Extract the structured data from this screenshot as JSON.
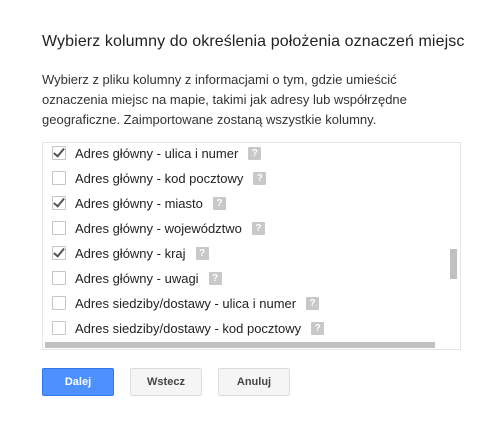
{
  "dialog": {
    "title": "Wybierz kolumny do określenia położenia oznaczeń miejsc",
    "description": "Wybierz z pliku kolumny z informacjami o tym, gdzie umieścić oznaczenia miejsc na mapie, takimi jak adresy lub współrzędne geograficzne. Zaimportowane zostaną wszystkie kolumny."
  },
  "columns": [
    {
      "label": "Adres główny - ulica i numer",
      "checked": true
    },
    {
      "label": "Adres główny - kod pocztowy",
      "checked": false
    },
    {
      "label": "Adres główny - miasto",
      "checked": true
    },
    {
      "label": "Adres główny - województwo",
      "checked": false
    },
    {
      "label": "Adres główny - kraj",
      "checked": true
    },
    {
      "label": "Adres główny - uwagi",
      "checked": false
    },
    {
      "label": "Adres siedziby/dostawy - ulica i numer",
      "checked": false
    },
    {
      "label": "Adres siedziby/dostawy - kod pocztowy",
      "checked": false
    }
  ],
  "help_glyph": "?",
  "buttons": {
    "next": "Dalej",
    "back": "Wstecz",
    "cancel": "Anuluj"
  },
  "colors": {
    "primary": "#4d90fe",
    "help_icon": "#c8c8c8"
  }
}
